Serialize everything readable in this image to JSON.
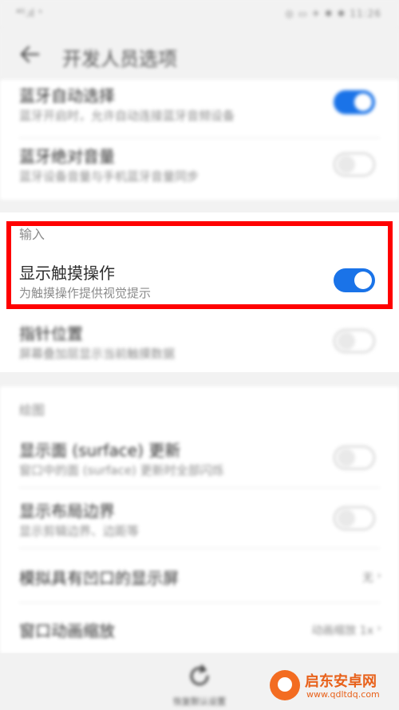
{
  "status_bar": {
    "left": "⁴ᴳ.ıl ⁺",
    "right": "◎ ▭ ✈ ✱ ✱ 11:26"
  },
  "app_bar": {
    "title": "开发人员选项"
  },
  "settings": {
    "bluetooth_codec": {
      "title": "蓝牙自动选择",
      "subtitle": "蓝牙开启时，允许自动连接蓝牙音频设备",
      "enabled": true
    },
    "bluetooth_volume": {
      "title": "蓝牙绝对音量",
      "subtitle": "蓝牙设备音量与手机蓝牙音量同步",
      "enabled": false
    },
    "input_section": "输入",
    "show_taps": {
      "title": "显示触摸操作",
      "subtitle": "为触摸操作提供视觉提示",
      "enabled": true
    },
    "pointer_location": {
      "title": "指针位置",
      "subtitle": "屏幕叠加层显示当前触摸数据",
      "enabled": false
    },
    "drawing_section": "绘图",
    "surface_updates": {
      "title": "显示面 (surface) 更新",
      "subtitle": "窗口中的面 (surface) 更新时全部闪烁",
      "enabled": false
    },
    "layout_bounds": {
      "title": "显示布局边界",
      "subtitle": "显示剪辑边界、边距等",
      "enabled": false
    },
    "simulate_display": {
      "title": "模拟具有凹口的显示屏",
      "value": "无"
    },
    "window_animation": {
      "title": "窗口动画缩放",
      "value": "动画缩放 1x"
    }
  },
  "bottom": {
    "reset_label": "恢复默认设置"
  },
  "watermark": {
    "name": "启东安卓网",
    "url": "www.qdltdq.com"
  },
  "colors": {
    "accent": "#1a73e8",
    "highlight": "#ff0000"
  }
}
